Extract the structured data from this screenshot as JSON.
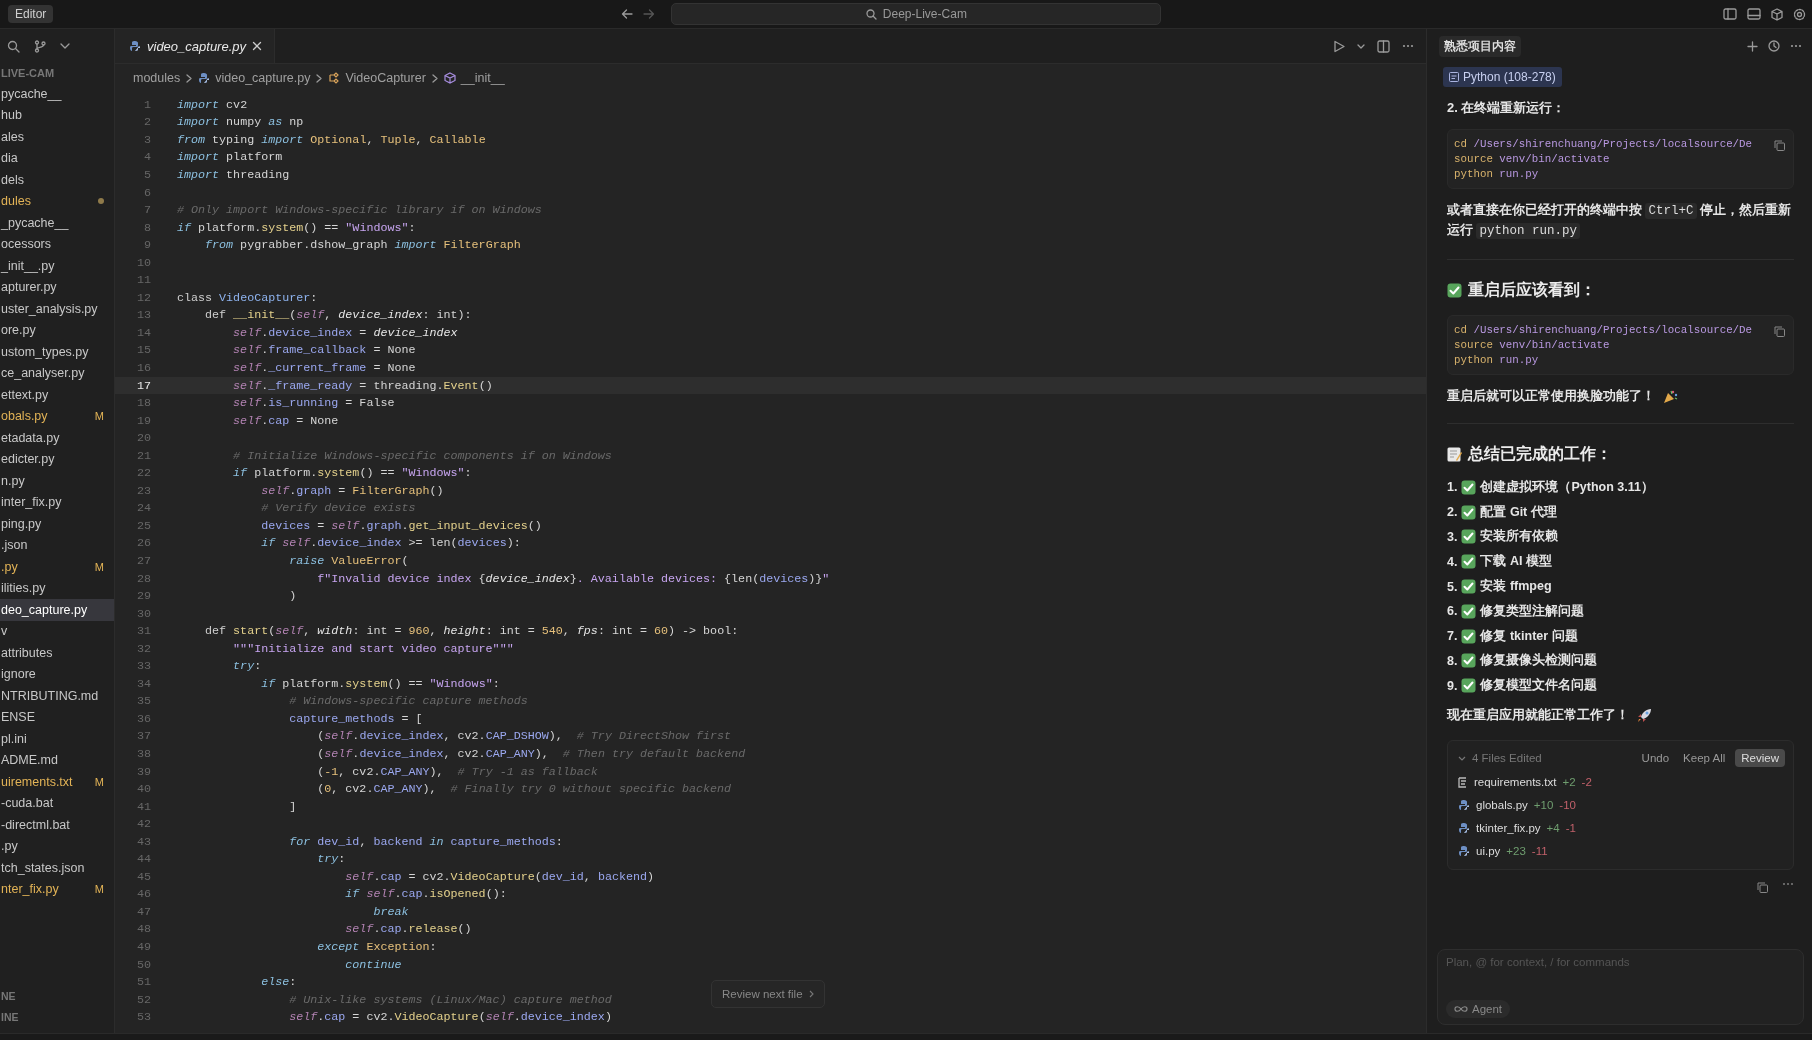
{
  "titlebar": {
    "label": "Editor",
    "search": "Deep-Live-Cam"
  },
  "sidebar": {
    "section": "LIVE-CAM",
    "items": [
      {
        "label": "pycache__",
        "selected": false,
        "modified": false
      },
      {
        "label": "hub",
        "selected": false,
        "modified": false
      },
      {
        "label": "ales",
        "selected": false,
        "modified": false
      },
      {
        "label": "dia",
        "selected": false,
        "modified": false
      },
      {
        "label": "dels",
        "selected": false,
        "modified": false
      },
      {
        "label": "dules",
        "selected": false,
        "modified": true
      },
      {
        "label": "_pycache__",
        "selected": false,
        "modified": false
      },
      {
        "label": "ocessors",
        "selected": false,
        "modified": false
      },
      {
        "label": "_init__.py",
        "selected": false,
        "modified": false
      },
      {
        "label": "apturer.py",
        "selected": false,
        "modified": false
      },
      {
        "label": "uster_analysis.py",
        "selected": false,
        "modified": false
      },
      {
        "label": "ore.py",
        "selected": false,
        "modified": false
      },
      {
        "label": "ustom_types.py",
        "selected": false,
        "modified": false
      },
      {
        "label": "ce_analyser.py",
        "selected": false,
        "modified": false
      },
      {
        "label": "ettext.py",
        "selected": false,
        "modified": false
      },
      {
        "label": "obals.py",
        "selected": false,
        "modified": true,
        "badge": "M"
      },
      {
        "label": "etadata.py",
        "selected": false,
        "modified": false
      },
      {
        "label": "edicter.py",
        "selected": false,
        "modified": false
      },
      {
        "label": "n.py",
        "selected": false,
        "modified": false
      },
      {
        "label": "inter_fix.py",
        "selected": false,
        "modified": false
      },
      {
        "label": "ping.py",
        "selected": false,
        "modified": false
      },
      {
        "label": ".json",
        "selected": false,
        "modified": false
      },
      {
        "label": ".py",
        "selected": false,
        "modified": true,
        "badge": "M"
      },
      {
        "label": "ilities.py",
        "selected": false,
        "modified": false
      },
      {
        "label": "deo_capture.py",
        "selected": true,
        "modified": false
      },
      {
        "label": "v",
        "selected": false,
        "modified": false
      },
      {
        "label": "attributes",
        "selected": false,
        "modified": false
      },
      {
        "label": "ignore",
        "selected": false,
        "modified": false
      },
      {
        "label": "NTRIBUTING.md",
        "selected": false,
        "modified": false
      },
      {
        "label": "ENSE",
        "selected": false,
        "modified": false
      },
      {
        "label": "pl.ini",
        "selected": false,
        "modified": false
      },
      {
        "label": "ADME.md",
        "selected": false,
        "modified": false
      },
      {
        "label": "uirements.txt",
        "selected": false,
        "modified": true,
        "badge": "M"
      },
      {
        "label": "-cuda.bat",
        "selected": false,
        "modified": false
      },
      {
        "label": "-directml.bat",
        "selected": false,
        "modified": false
      },
      {
        "label": ".py",
        "selected": false,
        "modified": false
      },
      {
        "label": "tch_states.json",
        "selected": false,
        "modified": false
      },
      {
        "label": "nter_fix.py",
        "selected": false,
        "modified": true,
        "badge": "M"
      }
    ],
    "footer": [
      "NE",
      "INE"
    ]
  },
  "editor": {
    "tab": "video_capture.py",
    "breadcrumb": [
      "modules",
      "video_capture.py",
      "VideoCapturer",
      "__init__"
    ],
    "review_button": "Review next file",
    "lines": [
      {
        "n": "1",
        "t": [
          {
            "kind": "k",
            "text": "import"
          },
          {
            "kind": "p",
            "text": " cv2"
          }
        ]
      },
      {
        "n": "2",
        "t": [
          {
            "kind": "k",
            "text": "import"
          },
          {
            "kind": "p",
            "text": " numpy "
          },
          {
            "kind": "k",
            "text": "as"
          },
          {
            "kind": "p",
            "text": " np"
          }
        ]
      },
      {
        "n": "3",
        "t": [
          {
            "kind": "k",
            "text": "from"
          },
          {
            "kind": "p",
            "text": " typing "
          },
          {
            "kind": "k",
            "text": "import "
          },
          {
            "kind": "t",
            "text": "Optional"
          },
          {
            "kind": "p",
            "text": ", "
          },
          {
            "kind": "t",
            "text": "Tuple"
          },
          {
            "kind": "p",
            "text": ", "
          },
          {
            "kind": "t",
            "text": "Callable"
          }
        ]
      },
      {
        "n": "4",
        "t": [
          {
            "kind": "k",
            "text": "import"
          },
          {
            "kind": "p",
            "text": " platform"
          }
        ]
      },
      {
        "n": "5",
        "t": [
          {
            "kind": "k",
            "text": "import"
          },
          {
            "kind": "p",
            "text": " threading"
          }
        ]
      },
      {
        "n": "6"
      },
      {
        "n": "7",
        "t": [
          {
            "kind": "c",
            "text": "# Only import Windows-specific library if on Windows"
          }
        ]
      },
      {
        "n": "8",
        "t": [
          {
            "kind": "k",
            "text": "if"
          },
          {
            "kind": "p",
            "text": " platform."
          },
          {
            "kind": "f",
            "text": "system"
          },
          {
            "kind": "p",
            "text": "() == "
          },
          {
            "kind": "s",
            "text": "\"Windows\""
          },
          {
            "kind": "p",
            "text": ":"
          }
        ]
      },
      {
        "n": "9",
        "t": [
          {
            "kind": "k",
            "text": "    from"
          },
          {
            "kind": "p",
            "text": " pygrabber.dshow_graph "
          },
          {
            "kind": "k",
            "text": "import "
          },
          {
            "kind": "t",
            "text": "FilterGraph"
          }
        ]
      },
      {
        "n": "10"
      },
      {
        "n": "11"
      },
      {
        "n": "12",
        "t": [
          {
            "kind": "d",
            "text": "class "
          },
          {
            "kind": "cl",
            "text": "VideoCapturer"
          },
          {
            "kind": "p",
            "text": ":"
          }
        ]
      },
      {
        "n": "13",
        "t": [
          {
            "kind": "d",
            "text": "    def "
          },
          {
            "kind": "f",
            "text": "__init__"
          },
          {
            "kind": "p",
            "text": "("
          },
          {
            "kind": "sf",
            "text": "self"
          },
          {
            "kind": "p",
            "text": ", "
          },
          {
            "kind": "pa",
            "text": "device_index"
          },
          {
            "kind": "p",
            "text": ": int):"
          }
        ]
      },
      {
        "n": "14",
        "t": [
          {
            "kind": "sf",
            "text": "        self"
          },
          {
            "kind": "p",
            "text": "."
          },
          {
            "kind": "a",
            "text": "device_index"
          },
          {
            "kind": "p",
            "text": " = "
          },
          {
            "kind": "pa",
            "text": "device_index"
          }
        ]
      },
      {
        "n": "15",
        "t": [
          {
            "kind": "sf",
            "text": "        self"
          },
          {
            "kind": "p",
            "text": "."
          },
          {
            "kind": "a",
            "text": "frame_callback"
          },
          {
            "kind": "p",
            "text": " = None"
          }
        ]
      },
      {
        "n": "16",
        "t": [
          {
            "kind": "sf",
            "text": "        self"
          },
          {
            "kind": "p",
            "text": "."
          },
          {
            "kind": "a",
            "text": "_current_frame"
          },
          {
            "kind": "p",
            "text": " = None"
          }
        ]
      },
      {
        "n": "17",
        "current": true,
        "t": [
          {
            "kind": "sf",
            "text": "        self"
          },
          {
            "kind": "p",
            "text": "."
          },
          {
            "kind": "a",
            "text": "_frame_ready"
          },
          {
            "kind": "p",
            "text": " = threading."
          },
          {
            "kind": "f",
            "text": "Event"
          },
          {
            "kind": "p",
            "text": "()"
          }
        ]
      },
      {
        "n": "18",
        "t": [
          {
            "kind": "sf",
            "text": "        self"
          },
          {
            "kind": "p",
            "text": "."
          },
          {
            "kind": "a",
            "text": "is_running"
          },
          {
            "kind": "p",
            "text": " = False"
          }
        ]
      },
      {
        "n": "19",
        "t": [
          {
            "kind": "sf",
            "text": "        self"
          },
          {
            "kind": "p",
            "text": "."
          },
          {
            "kind": "a",
            "text": "cap"
          },
          {
            "kind": "p",
            "text": " = None"
          }
        ]
      },
      {
        "n": "20"
      },
      {
        "n": "21",
        "t": [
          {
            "kind": "c",
            "text": "        # Initialize Windows-specific components if on Windows"
          }
        ]
      },
      {
        "n": "22",
        "t": [
          {
            "kind": "k",
            "text": "        if"
          },
          {
            "kind": "p",
            "text": " platform."
          },
          {
            "kind": "f",
            "text": "system"
          },
          {
            "kind": "p",
            "text": "() == "
          },
          {
            "kind": "s",
            "text": "\"Windows\""
          },
          {
            "kind": "p",
            "text": ":"
          }
        ]
      },
      {
        "n": "23",
        "t": [
          {
            "kind": "sf",
            "text": "            self"
          },
          {
            "kind": "p",
            "text": "."
          },
          {
            "kind": "a",
            "text": "graph"
          },
          {
            "kind": "p",
            "text": " = "
          },
          {
            "kind": "t",
            "text": "FilterGraph"
          },
          {
            "kind": "p",
            "text": "()"
          }
        ]
      },
      {
        "n": "24",
        "t": [
          {
            "kind": "c",
            "text": "            # Verify device exists"
          }
        ]
      },
      {
        "n": "25",
        "t": [
          {
            "kind": "a",
            "text": "            devices"
          },
          {
            "kind": "p",
            "text": " = "
          },
          {
            "kind": "sf",
            "text": "self"
          },
          {
            "kind": "p",
            "text": "."
          },
          {
            "kind": "a",
            "text": "graph"
          },
          {
            "kind": "p",
            "text": "."
          },
          {
            "kind": "f",
            "text": "get_input_devices"
          },
          {
            "kind": "p",
            "text": "()"
          }
        ]
      },
      {
        "n": "26",
        "t": [
          {
            "kind": "k",
            "text": "            if "
          },
          {
            "kind": "sf",
            "text": "self"
          },
          {
            "kind": "p",
            "text": "."
          },
          {
            "kind": "a",
            "text": "device_index"
          },
          {
            "kind": "p",
            "text": " >= len("
          },
          {
            "kind": "a",
            "text": "devices"
          },
          {
            "kind": "p",
            "text": "):"
          }
        ]
      },
      {
        "n": "27",
        "t": [
          {
            "kind": "k",
            "text": "                raise "
          },
          {
            "kind": "t",
            "text": "ValueError"
          },
          {
            "kind": "p",
            "text": "("
          }
        ]
      },
      {
        "n": "28",
        "t": [
          {
            "kind": "s",
            "text": "                    f\"Invalid device index "
          },
          {
            "kind": "p",
            "text": "{"
          },
          {
            "kind": "pa",
            "text": "device_index"
          },
          {
            "kind": "p",
            "text": "}"
          },
          {
            "kind": "s",
            "text": ". Available devices: "
          },
          {
            "kind": "p",
            "text": "{len("
          },
          {
            "kind": "a",
            "text": "devices"
          },
          {
            "kind": "p",
            "text": ")}"
          },
          {
            "kind": "s",
            "text": "\""
          }
        ]
      },
      {
        "n": "29",
        "t": [
          {
            "kind": "p",
            "text": "                )"
          }
        ]
      },
      {
        "n": "30"
      },
      {
        "n": "31",
        "t": [
          {
            "kind": "d",
            "text": "    def "
          },
          {
            "kind": "f",
            "text": "start"
          },
          {
            "kind": "p",
            "text": "("
          },
          {
            "kind": "sf",
            "text": "self"
          },
          {
            "kind": "p",
            "text": ", "
          },
          {
            "kind": "pa",
            "text": "width"
          },
          {
            "kind": "p",
            "text": ": int = "
          },
          {
            "kind": "n",
            "text": "960"
          },
          {
            "kind": "p",
            "text": ", "
          },
          {
            "kind": "pa",
            "text": "height"
          },
          {
            "kind": "p",
            "text": ": int = "
          },
          {
            "kind": "n",
            "text": "540"
          },
          {
            "kind": "p",
            "text": ", "
          },
          {
            "kind": "pa",
            "text": "fps"
          },
          {
            "kind": "p",
            "text": ": int = "
          },
          {
            "kind": "n",
            "text": "60"
          },
          {
            "kind": "p",
            "text": ") -> bool:"
          }
        ]
      },
      {
        "n": "32",
        "t": [
          {
            "kind": "s",
            "text": "        \"\"\"Initialize and start video capture\"\"\""
          }
        ]
      },
      {
        "n": "33",
        "t": [
          {
            "kind": "k",
            "text": "        try"
          },
          {
            "kind": "p",
            "text": ":"
          }
        ]
      },
      {
        "n": "34",
        "t": [
          {
            "kind": "k",
            "text": "            if"
          },
          {
            "kind": "p",
            "text": " platform."
          },
          {
            "kind": "f",
            "text": "system"
          },
          {
            "kind": "p",
            "text": "() == "
          },
          {
            "kind": "s",
            "text": "\"Windows\""
          },
          {
            "kind": "p",
            "text": ":"
          }
        ]
      },
      {
        "n": "35",
        "t": [
          {
            "kind": "c",
            "text": "                # Windows-specific capture methods"
          }
        ]
      },
      {
        "n": "36",
        "t": [
          {
            "kind": "a",
            "text": "                capture_methods"
          },
          {
            "kind": "p",
            "text": " = ["
          }
        ]
      },
      {
        "n": "37",
        "t": [
          {
            "kind": "p",
            "text": "                    ("
          },
          {
            "kind": "sf",
            "text": "self"
          },
          {
            "kind": "p",
            "text": "."
          },
          {
            "kind": "a",
            "text": "device_index"
          },
          {
            "kind": "p",
            "text": ", cv2."
          },
          {
            "kind": "a",
            "text": "CAP_DSHOW"
          },
          {
            "kind": "p",
            "text": "),  "
          },
          {
            "kind": "c",
            "text": "# Try DirectShow first"
          }
        ]
      },
      {
        "n": "38",
        "t": [
          {
            "kind": "p",
            "text": "                    ("
          },
          {
            "kind": "sf",
            "text": "self"
          },
          {
            "kind": "p",
            "text": "."
          },
          {
            "kind": "a",
            "text": "device_index"
          },
          {
            "kind": "p",
            "text": ", cv2."
          },
          {
            "kind": "a",
            "text": "CAP_ANY"
          },
          {
            "kind": "p",
            "text": "),  "
          },
          {
            "kind": "c",
            "text": "# Then try default backend"
          }
        ]
      },
      {
        "n": "39",
        "t": [
          {
            "kind": "p",
            "text": "                    ("
          },
          {
            "kind": "n",
            "text": "-1"
          },
          {
            "kind": "p",
            "text": ", cv2."
          },
          {
            "kind": "a",
            "text": "CAP_ANY"
          },
          {
            "kind": "p",
            "text": "),  "
          },
          {
            "kind": "c",
            "text": "# Try -1 as fallback"
          }
        ]
      },
      {
        "n": "40",
        "t": [
          {
            "kind": "p",
            "text": "                    ("
          },
          {
            "kind": "n",
            "text": "0"
          },
          {
            "kind": "p",
            "text": ", cv2."
          },
          {
            "kind": "a",
            "text": "CAP_ANY"
          },
          {
            "kind": "p",
            "text": "),  "
          },
          {
            "kind": "c",
            "text": "# Finally try 0 without specific backend"
          }
        ]
      },
      {
        "n": "41",
        "t": [
          {
            "kind": "p",
            "text": "                ]"
          }
        ]
      },
      {
        "n": "42"
      },
      {
        "n": "43",
        "t": [
          {
            "kind": "k",
            "text": "                for "
          },
          {
            "kind": "a",
            "text": "dev_id"
          },
          {
            "kind": "p",
            "text": ", "
          },
          {
            "kind": "a",
            "text": "backend "
          },
          {
            "kind": "k",
            "text": "in "
          },
          {
            "kind": "a",
            "text": "capture_methods"
          },
          {
            "kind": "p",
            "text": ":"
          }
        ]
      },
      {
        "n": "44",
        "t": [
          {
            "kind": "k",
            "text": "                    try"
          },
          {
            "kind": "p",
            "text": ":"
          }
        ]
      },
      {
        "n": "45",
        "t": [
          {
            "kind": "sf",
            "text": "                        self"
          },
          {
            "kind": "p",
            "text": "."
          },
          {
            "kind": "a",
            "text": "cap"
          },
          {
            "kind": "p",
            "text": " = cv2."
          },
          {
            "kind": "f",
            "text": "VideoCapture"
          },
          {
            "kind": "p",
            "text": "("
          },
          {
            "kind": "a",
            "text": "dev_id"
          },
          {
            "kind": "p",
            "text": ", "
          },
          {
            "kind": "a",
            "text": "backend"
          },
          {
            "kind": "p",
            "text": ")"
          }
        ]
      },
      {
        "n": "46",
        "t": [
          {
            "kind": "k",
            "text": "                        if "
          },
          {
            "kind": "sf",
            "text": "self"
          },
          {
            "kind": "p",
            "text": "."
          },
          {
            "kind": "a",
            "text": "cap"
          },
          {
            "kind": "p",
            "text": "."
          },
          {
            "kind": "f",
            "text": "isOpened"
          },
          {
            "kind": "p",
            "text": "():"
          }
        ]
      },
      {
        "n": "47",
        "t": [
          {
            "kind": "k",
            "text": "                            break"
          }
        ]
      },
      {
        "n": "48",
        "t": [
          {
            "kind": "sf",
            "text": "                        self"
          },
          {
            "kind": "p",
            "text": "."
          },
          {
            "kind": "a",
            "text": "cap"
          },
          {
            "kind": "p",
            "text": "."
          },
          {
            "kind": "f",
            "text": "release"
          },
          {
            "kind": "p",
            "text": "()"
          }
        ]
      },
      {
        "n": "49",
        "t": [
          {
            "kind": "k",
            "text": "                    except "
          },
          {
            "kind": "t",
            "text": "Exception"
          },
          {
            "kind": "p",
            "text": ":"
          }
        ]
      },
      {
        "n": "50",
        "t": [
          {
            "kind": "k",
            "text": "                        continue"
          }
        ]
      },
      {
        "n": "51",
        "t": [
          {
            "kind": "k",
            "text": "            else"
          },
          {
            "kind": "p",
            "text": ":"
          }
        ]
      },
      {
        "n": "52",
        "t": [
          {
            "kind": "c",
            "text": "                # Unix-like systems (Linux/Mac) capture method"
          }
        ]
      },
      {
        "n": "53",
        "t": [
          {
            "kind": "sf",
            "text": "                self"
          },
          {
            "kind": "p",
            "text": "."
          },
          {
            "kind": "a",
            "text": "cap"
          },
          {
            "kind": "p",
            "text": " = cv2."
          },
          {
            "kind": "f",
            "text": "VideoCapture"
          },
          {
            "kind": "p",
            "text": "("
          },
          {
            "kind": "sf",
            "text": "self"
          },
          {
            "kind": "p",
            "text": "."
          },
          {
            "kind": "a",
            "text": "device_index"
          },
          {
            "kind": "p",
            "text": ")"
          }
        ]
      }
    ]
  },
  "chat": {
    "title": "熟悉项目内容",
    "context_chip": "Python (108-278)",
    "blocks": [
      {
        "kind": "text",
        "text": "2. 在终端重新运行："
      },
      {
        "kind": "code",
        "lines": [
          {
            "cmd": "cd",
            "arg": "/Users/shirenchuang/Projects/localsource/De"
          },
          {
            "cmd": "source",
            "arg": "venv/bin/activate"
          },
          {
            "cmd": "python",
            "arg": "run.py"
          }
        ]
      },
      {
        "kind": "para",
        "parts": [
          {
            "kind": "text",
            "text": "或者直接在你已经打开的终端中按 "
          },
          {
            "kind": "code",
            "text": "Ctrl+C"
          },
          {
            "kind": "text",
            "text": " 停止，然后重新运行 "
          },
          {
            "kind": "code",
            "text": "python run.py"
          }
        ]
      },
      {
        "kind": "rule"
      },
      {
        "kind": "check_heading",
        "text": "重启后应该看到："
      },
      {
        "kind": "code",
        "lines": [
          {
            "cmd": "cd",
            "arg": "/Users/shirenchuang/Projects/localsource/De"
          },
          {
            "cmd": "source",
            "arg": "venv/bin/activate"
          },
          {
            "cmd": "python",
            "arg": "run.py"
          }
        ]
      },
      {
        "kind": "celebration_text",
        "text": "重启后就可以正常使用换脸功能了！"
      },
      {
        "kind": "rule"
      },
      {
        "kind": "memo_heading",
        "text": "总结已完成的工作："
      },
      {
        "kind": "list",
        "items": [
          {
            "n": "1.",
            "text": "创建虚拟环境（Python 3.11）"
          },
          {
            "n": "2.",
            "text": "配置 Git 代理"
          },
          {
            "n": "3.",
            "text": "安装所有依赖"
          },
          {
            "n": "4.",
            "text": "下载 AI 模型"
          },
          {
            "n": "5.",
            "text": "安装 ffmpeg"
          },
          {
            "n": "6.",
            "text": "修复类型注解问题"
          },
          {
            "n": "7.",
            "text": "修复 tkinter 问题"
          },
          {
            "n": "8.",
            "text": "修复摄像头检测问题"
          },
          {
            "n": "9.",
            "text": "修复模型文件名问题"
          }
        ]
      },
      {
        "kind": "rocket_text",
        "text": "现在重启应用就能正常工作了！"
      }
    ],
    "files_card": {
      "title": "4 Files Edited",
      "actions": [
        "Undo",
        "Keep All"
      ],
      "primary": "Review",
      "files": [
        {
          "kind": "text",
          "name": "requirements.txt",
          "added": "+2",
          "removed": "-2"
        },
        {
          "kind": "python",
          "name": "globals.py",
          "added": "+10",
          "removed": "-10"
        },
        {
          "kind": "python",
          "name": "tkinter_fix.py",
          "added": "+4",
          "removed": "-1"
        },
        {
          "kind": "python",
          "name": "ui.py",
          "added": "+23",
          "removed": "-11"
        }
      ]
    },
    "input": {
      "placeholder": "Plan, @ for context, / for commands",
      "mode": "Agent"
    }
  }
}
